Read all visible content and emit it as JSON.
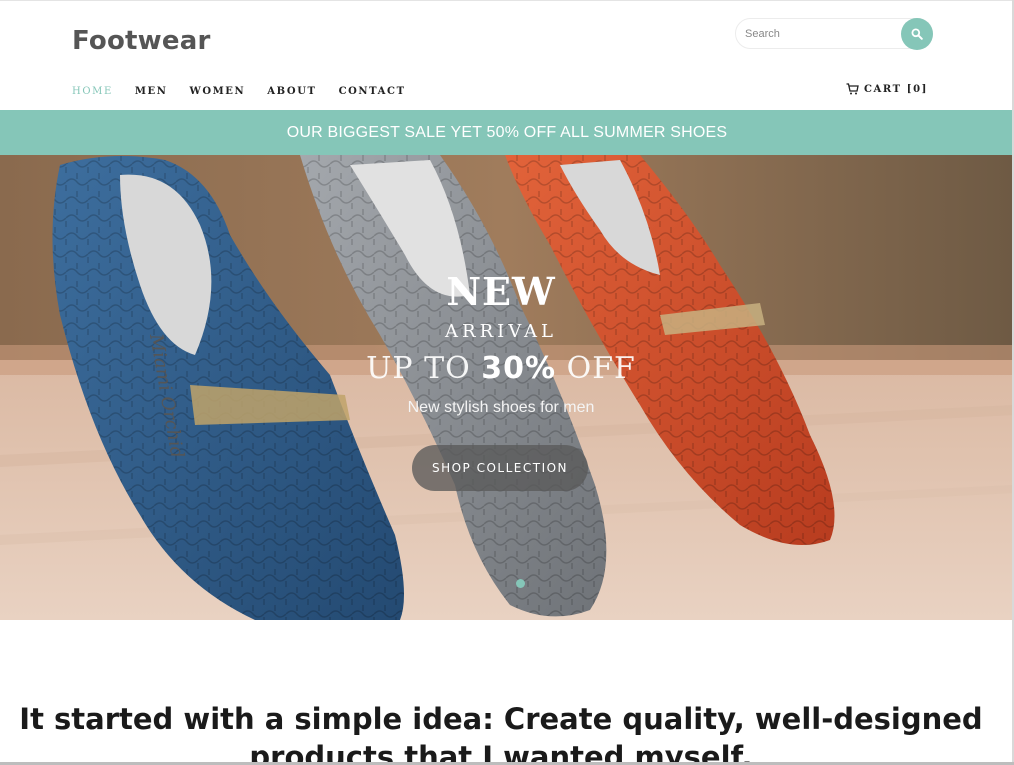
{
  "header": {
    "logo": "Footwear",
    "search_placeholder": "Search"
  },
  "nav": {
    "items": [
      {
        "label": "HOME",
        "active": true
      },
      {
        "label": "MEN"
      },
      {
        "label": "WOMEN"
      },
      {
        "label": "ABOUT"
      },
      {
        "label": "CONTACT"
      }
    ],
    "cart_label": "CART [0]"
  },
  "promo": {
    "text": "OUR BIGGEST SALE YET 50% OFF ALL SUMMER SHOES"
  },
  "hero": {
    "title": "NEW",
    "subtitle": "ARRIVAL",
    "offer_pre": "UP TO ",
    "offer_value": "30%",
    "offer_post": " OFF",
    "tagline": "New stylish shoes for men",
    "cta": "SHOP COLLECTION",
    "insole_text": "Miami Orchid"
  },
  "content": {
    "headline": "It started with a simple idea: Create quality, well-designed products that I wanted myself."
  },
  "colors": {
    "accent": "#85c6b8",
    "blue_shoe": "#2f5e8c",
    "grey_shoe": "#8e9297",
    "red_shoe": "#d4532f"
  },
  "icons": {
    "search": "search-icon",
    "cart": "cart-icon"
  }
}
